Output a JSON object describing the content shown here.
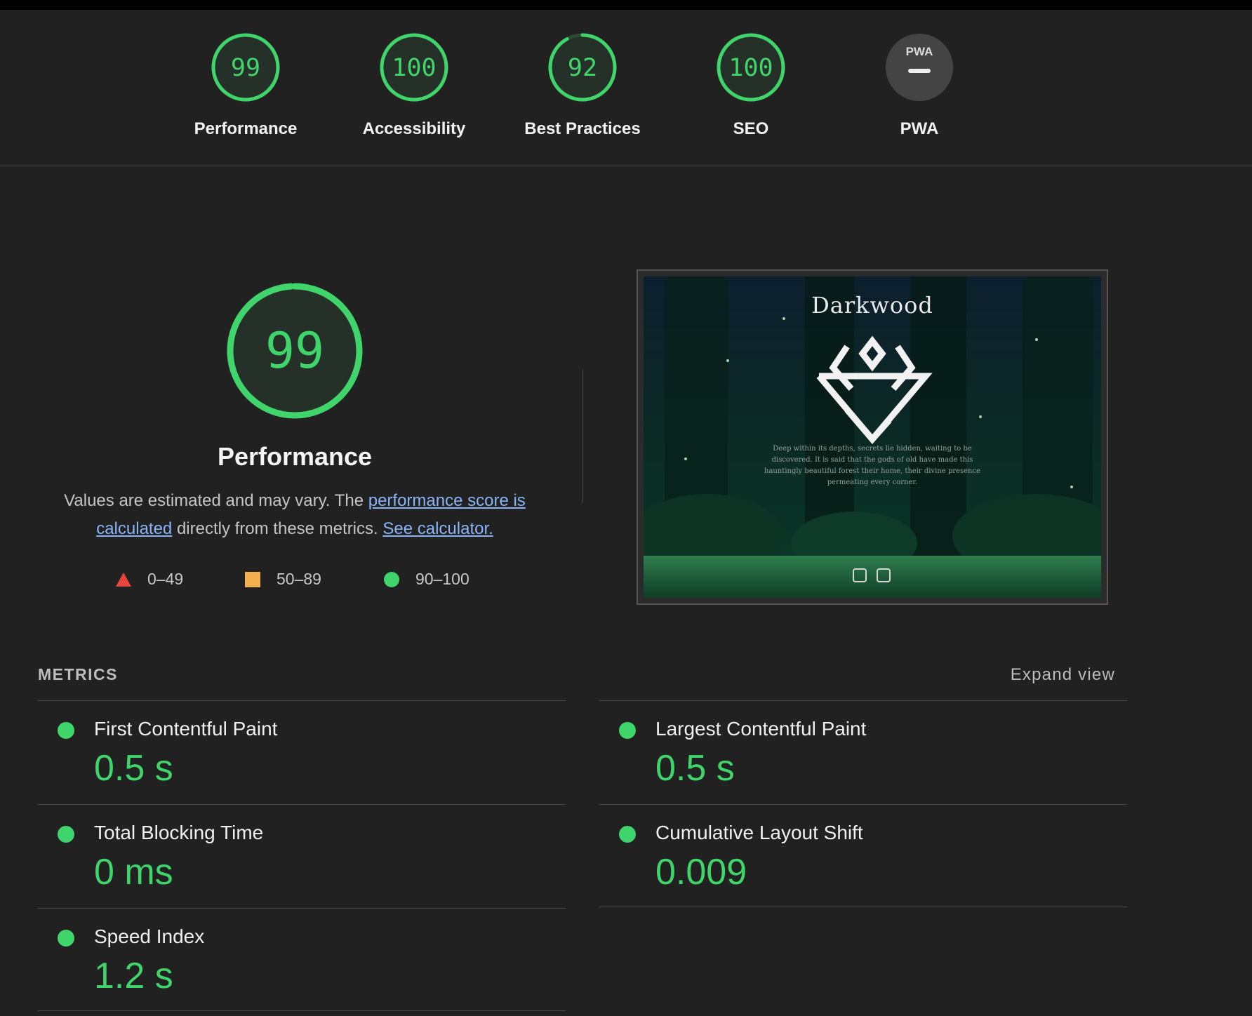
{
  "gauges": [
    {
      "score": "99",
      "label": "Performance",
      "fraction": 0.99
    },
    {
      "score": "100",
      "label": "Accessibility",
      "fraction": 1.0
    },
    {
      "score": "92",
      "label": "Best Practices",
      "fraction": 0.92
    },
    {
      "score": "100",
      "label": "SEO",
      "fraction": 1.0
    },
    {
      "score": "PWA",
      "label": "PWA",
      "fraction": 0
    }
  ],
  "performance": {
    "score": "99",
    "title": "Performance",
    "desc_prefix": "Values are estimated and may vary. The ",
    "link_score": "performance score is calculated",
    "desc_middle": " directly from these metrics. ",
    "link_calc": "See calculator.",
    "legend": [
      {
        "range": "0–49",
        "icon": "triangle-icon",
        "color": "#e8453c"
      },
      {
        "range": "50–89",
        "icon": "square-icon",
        "color": "#f4b04f"
      },
      {
        "range": "90–100",
        "icon": "circle-icon",
        "color": "#3fd56b"
      }
    ]
  },
  "screenshot": {
    "title": "Darkwood",
    "text": "Deep within its depths, secrets lie hidden, waiting to be discovered. It is said that the gods of old have made this hauntingly beautiful forest their home, their divine presence permeating every corner."
  },
  "metrics": {
    "header": "METRICS",
    "expand": "Expand view",
    "items": [
      {
        "name": "First Contentful Paint",
        "value": "0.5 s"
      },
      {
        "name": "Largest Contentful Paint",
        "value": "0.5 s"
      },
      {
        "name": "Total Blocking Time",
        "value": "0 ms"
      },
      {
        "name": "Cumulative Layout Shift",
        "value": "0.009"
      },
      {
        "name": "Speed Index",
        "value": "1.2 s"
      }
    ]
  },
  "colors": {
    "pass": "#3fd56b",
    "average": "#f4b04f",
    "fail": "#e8453c",
    "background": "#212121"
  }
}
